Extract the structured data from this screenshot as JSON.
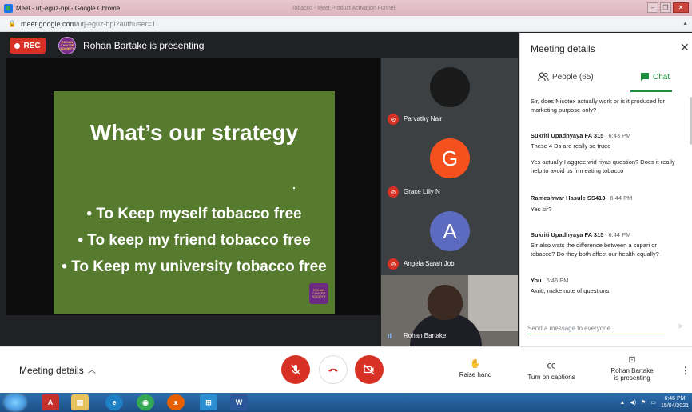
{
  "window": {
    "title": "Meet - utj-eguz-hpi - Google Chrome",
    "faded_text": "Tobacco - Meet Product Activation Funnel"
  },
  "address": {
    "url_host": "meet.google.com",
    "url_path": "/utj-eguz-hpi?authuser=1"
  },
  "stage": {
    "rec_label": "REC",
    "presenting_label": "Rohan Bartake is presenting",
    "avatar_text": "ROHAN CANCER SOCIETY"
  },
  "slide": {
    "title": "What’s our strategy",
    "bullets": [
      "• To Keep myself tobacco free",
      "• To keep my friend tobacco free",
      "• To Keep my university tobacco free"
    ],
    "logo_text": "ROHAN CANCER SOCIETY"
  },
  "participants": [
    {
      "name": "Parvathy Nair",
      "initial": "",
      "color": "#1a1a1a"
    },
    {
      "name": "Grace Lilly N",
      "initial": "G",
      "color": "#f4511e"
    },
    {
      "name": "Angela Sarah Job",
      "initial": "A",
      "color": "#5c6bc0"
    }
  ],
  "active_speaker": {
    "name": "Rohan Bartake"
  },
  "panel": {
    "title": "Meeting details",
    "tab_people": "People (65)",
    "tab_chat": "Chat",
    "messages": [
      {
        "sender": "",
        "time": "",
        "text": "Sir, does Nicotex actually work or is it produced for marketing purpose only?"
      },
      {
        "sender": "Sukriti Upadhyaya FA 315",
        "time": "6:43 PM",
        "text": "These 4 Ds are really so truee"
      },
      {
        "sender": "",
        "time": "",
        "text": "Yes actually I aggree wid riyas question? Does it really help to avoid us frm eating tobacco"
      },
      {
        "sender": "Rameshwar Hasule SS413",
        "time": "6:44 PM",
        "text": "Yes sir?"
      },
      {
        "sender": "Sukriti Upadhyaya FA 315",
        "time": "6:44 PM",
        "text": "Sir also wats the difference between a supari or tobacco? Do they both affect our health equally?"
      },
      {
        "sender": "You",
        "time": "6:46 PM",
        "text": "Akriti, make note of questions"
      }
    ],
    "input_placeholder": "Send a message to everyone"
  },
  "bottom": {
    "details_label": "Meeting details",
    "raise_hand": "Raise hand",
    "captions": "Turn on captions",
    "presenting_line1": "Rohan Bartake",
    "presenting_line2": "is presenting"
  },
  "taskbar": {
    "time": "6:46 PM",
    "date": "15/04/2021"
  }
}
